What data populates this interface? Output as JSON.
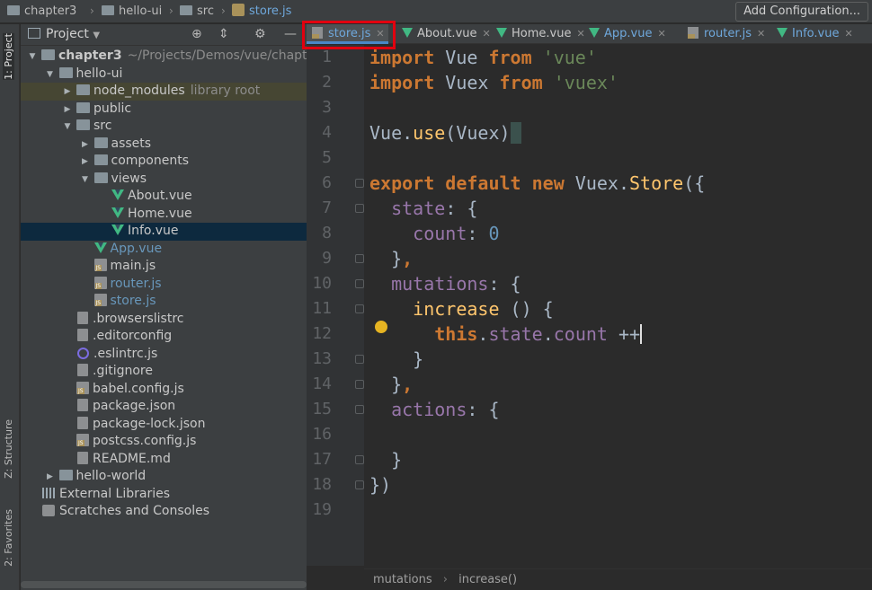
{
  "breadcrumb": {
    "items": [
      "chapter3",
      "hello-ui",
      "src",
      "store.js"
    ],
    "separators": [
      "›",
      "›",
      "›"
    ]
  },
  "toolbar": {
    "add_configuration": "Add Configuration..."
  },
  "left_strip": {
    "project_tab": "1: Project",
    "structure_tab": "Z: Structure",
    "favorites_tab": "2: Favorites"
  },
  "project_panel": {
    "title": "Project",
    "tree": [
      {
        "label": "chapter3",
        "extra": "~/Projects/Demos/vue/chapte",
        "type": "folder",
        "level": 0,
        "expanded": true
      },
      {
        "label": "hello-ui",
        "type": "folder",
        "level": 1,
        "expanded": true
      },
      {
        "label": "node_modules",
        "extra": "library root",
        "type": "folder",
        "level": 2,
        "expanded": false
      },
      {
        "label": "public",
        "type": "folder",
        "level": 2,
        "expanded": false
      },
      {
        "label": "src",
        "type": "folder",
        "level": 2,
        "expanded": true
      },
      {
        "label": "assets",
        "type": "folder",
        "level": 3,
        "expanded": false
      },
      {
        "label": "components",
        "type": "folder",
        "level": 3,
        "expanded": false
      },
      {
        "label": "views",
        "type": "folder",
        "level": 3,
        "expanded": true
      },
      {
        "label": "About.vue",
        "type": "vue",
        "level": 4
      },
      {
        "label": "Home.vue",
        "type": "vue",
        "level": 4
      },
      {
        "label": "Info.vue",
        "type": "vue",
        "level": 4,
        "selected": true
      },
      {
        "label": "App.vue",
        "type": "vue",
        "level": 3,
        "modified": true
      },
      {
        "label": "main.js",
        "type": "js",
        "level": 3
      },
      {
        "label": "router.js",
        "type": "js",
        "level": 3,
        "modified": true
      },
      {
        "label": "store.js",
        "type": "js",
        "level": 3,
        "modified": true
      },
      {
        "label": ".browserslistrc",
        "type": "txt",
        "level": 2
      },
      {
        "label": ".editorconfig",
        "type": "txt",
        "level": 2
      },
      {
        "label": ".eslintrc.js",
        "type": "eslint",
        "level": 2
      },
      {
        "label": ".gitignore",
        "type": "txt",
        "level": 2
      },
      {
        "label": "babel.config.js",
        "type": "js",
        "level": 2
      },
      {
        "label": "package.json",
        "type": "txt",
        "level": 2
      },
      {
        "label": "package-lock.json",
        "type": "txt",
        "level": 2
      },
      {
        "label": "postcss.config.js",
        "type": "js",
        "level": 2
      },
      {
        "label": "README.md",
        "type": "txt",
        "level": 2
      },
      {
        "label": "hello-world",
        "type": "folder",
        "level": 1,
        "expanded": false
      },
      {
        "label": "External Libraries",
        "type": "lib",
        "level": 0
      },
      {
        "label": "Scratches and Consoles",
        "type": "scratch",
        "level": 0
      }
    ]
  },
  "editor_tabs": [
    {
      "label": "store.js",
      "type": "js",
      "active": true
    },
    {
      "label": "About.vue",
      "type": "vue"
    },
    {
      "label": "Home.vue",
      "type": "vue"
    },
    {
      "label": "App.vue",
      "type": "vue",
      "modified": true
    },
    {
      "label": "router.js",
      "type": "js",
      "modified": true
    },
    {
      "label": "Info.vue",
      "type": "vue",
      "modified": true
    }
  ],
  "code_lines": [
    "import Vue from 'vue'",
    "import Vuex from 'vuex'",
    "",
    "Vue.use(Vuex)",
    "",
    "export default new Vuex.Store({",
    "  state: {",
    "    count: 0",
    "  },",
    "  mutations: {",
    "    increase () {",
    "      this.state.count ++",
    "    }",
    "  },",
    "  actions: {",
    "",
    "  }",
    "})",
    ""
  ],
  "status": {
    "crumb1": "mutations",
    "crumb2": "increase()",
    "sep": "›"
  },
  "colors": {
    "active_tab_highlight": "#e2000f",
    "selection": "#0d293e",
    "vue_green": "#41b883"
  }
}
